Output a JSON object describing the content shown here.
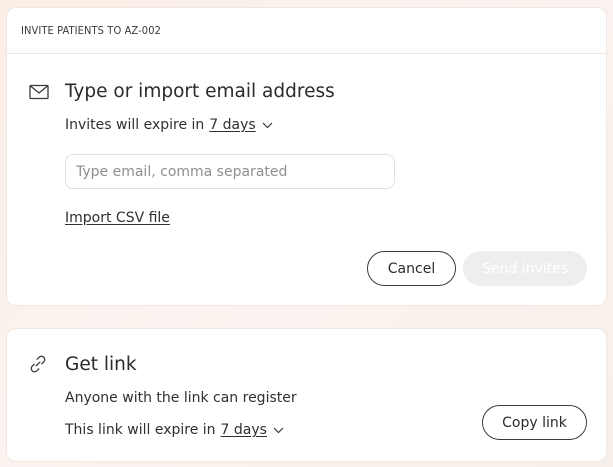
{
  "invite": {
    "header": "INVITE PATIENTS TO AZ-002",
    "title": "Type or import email address",
    "expire_prefix": "Invites will expire in",
    "expire_value": "7 days",
    "email_placeholder": "Type email, comma separated",
    "email_value": "",
    "import_label": "Import CSV file",
    "cancel_label": "Cancel",
    "send_label": "Send invites",
    "icon": "mail-icon"
  },
  "link": {
    "title": "Get link",
    "description": "Anyone with the link can register",
    "expire_prefix": "This link will expire in",
    "expire_value": "7 days",
    "copy_label": "Copy link",
    "icon": "link-icon"
  },
  "colors": {
    "background": "#fbeee6",
    "card": "#ffffff",
    "disabled_button": "#eeeeee",
    "text": "#2b2b2b"
  }
}
